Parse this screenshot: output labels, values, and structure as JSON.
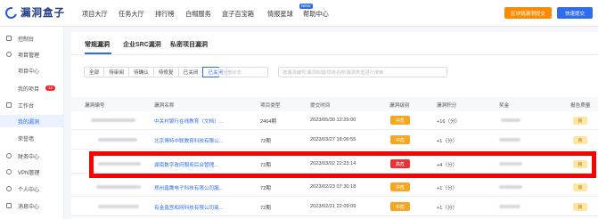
{
  "header": {
    "logo_text": "漏洞盒子",
    "nav": [
      "项目大厅",
      "任务大厅",
      "排行榜",
      "白帽服务",
      "盒子百宝箱",
      "情报星球",
      "帮助中心"
    ],
    "hot_badge": "NEW",
    "btn_orange": "区块链漏洞提交",
    "btn_blue": "快速提交"
  },
  "sidebar": {
    "items": [
      {
        "label": "控制台"
      },
      {
        "label": "项目管理"
      },
      {
        "label": "项目中心"
      },
      {
        "label": "我的项目",
        "badge": "12"
      },
      {
        "label": "工作台"
      },
      {
        "label": "我的漏洞"
      },
      {
        "label": "荣誉墙"
      },
      {
        "label": "财务中心"
      },
      {
        "label": "VPN管理"
      },
      {
        "label": "个人中心"
      },
      {
        "label": "消息中心"
      }
    ]
  },
  "tabs": [
    "常规漏洞",
    "企业SRC漏洞",
    "私密项目漏洞"
  ],
  "filters": [
    "全部",
    "待审阅",
    "待确认",
    "待修复",
    "已关闭",
    "已关闭"
  ],
  "search": {
    "status_placeholder": "全部状态",
    "keyword_placeholder": "按漏洞编号/漏洞标题/项目名称/漏洞类型进行搜索"
  },
  "table": {
    "headers": [
      "漏洞编号",
      "漏洞名称",
      "项目类型",
      "提交时间",
      "漏洞级别",
      "漏洞积分",
      "奖金",
      "报告质量"
    ],
    "rows": [
      {
        "name": "中关村银行在线教育（文档）...",
        "type": "2464期",
        "time": "2023/05/30 12:29:00",
        "level": "中危",
        "score": "+16（分）",
        "report": "良"
      },
      {
        "name": "北京博特中联教育科技有限公...",
        "type": "72期",
        "time": "2023/03/27 18:06:55",
        "level": "中危",
        "score": "+1（分）",
        "report": "良"
      },
      {
        "name": "湖南数字政府服务后台管理...",
        "type": "72期",
        "time": "2023/03/02 22:23:14",
        "level": "高危",
        "score": "+4（分）",
        "report": "良"
      },
      {
        "name": "郑州鑫鹰电子科技有限公司服...",
        "type": "72期",
        "time": "2023/02/23 07:30:18",
        "level": "中危",
        "score": "+1（分）",
        "report": "良"
      },
      {
        "name": "有金鑫宫和网科技有限公司商...",
        "type": "72期",
        "time": "2023/02/21 22:09:09",
        "level": "中危",
        "score": "+1（分）",
        "report": "良"
      }
    ]
  },
  "colors": {
    "accent": "#2d6cf0",
    "mid": "#f5a623",
    "high": "#e5333a",
    "highlight": "#ff0000"
  }
}
